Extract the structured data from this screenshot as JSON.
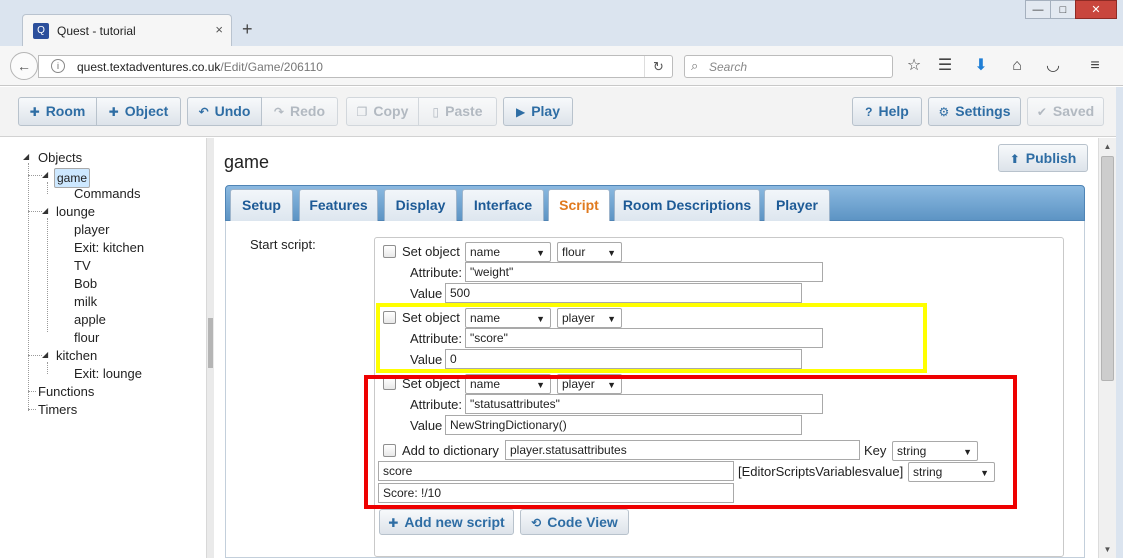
{
  "browser": {
    "tab_title": "Quest - tutorial",
    "tab_close": "×",
    "new_tab": "+",
    "url_host": "quest.textadventures.co.uk",
    "url_path": "/Edit/Game/206110",
    "search_placeholder": "Search",
    "win_minimize": "—",
    "win_maximize": "□",
    "win_close": "✕"
  },
  "toolbar": {
    "room": "Room",
    "object": "Object",
    "undo": "Undo",
    "redo": "Redo",
    "copy": "Copy",
    "paste": "Paste",
    "play": "Play",
    "help": "Help",
    "settings": "Settings",
    "saved": "Saved"
  },
  "tree": {
    "objects": "Objects",
    "game": "game",
    "commands": "Commands",
    "lounge": "lounge",
    "player": "player",
    "exit_kitchen": "Exit: kitchen",
    "tv": "TV",
    "bob": "Bob",
    "milk": "milk",
    "apple": "apple",
    "flour": "flour",
    "kitchen": "kitchen",
    "exit_lounge": "Exit: lounge",
    "functions": "Functions",
    "timers": "Timers"
  },
  "editor": {
    "title": "game",
    "publish": "Publish",
    "tabs": [
      "Setup",
      "Features",
      "Display",
      "Interface",
      "Script",
      "Room Descriptions",
      "Player"
    ],
    "start_script_label": "Start script:"
  },
  "script": {
    "set_object_label": "Set object",
    "attribute_label": "Attribute:",
    "value_label": "Value",
    "blocks": [
      {
        "mode": "name",
        "object": "flour",
        "attribute": "\"weight\"",
        "value": "500"
      },
      {
        "mode": "name",
        "object": "player",
        "attribute": "\"score\"",
        "value": "0"
      },
      {
        "mode": "name",
        "object": "player",
        "attribute": "\"statusattributes\"",
        "value": "NewStringDictionary()"
      }
    ],
    "add_to_dict": {
      "label": "Add to dictionary",
      "dictionary": "player.statusattributes",
      "key_label": "Key",
      "key_type": "string",
      "key_value": "score",
      "value_label": "[EditorScriptsVariablesvalue]",
      "value_type": "string",
      "value_value": "Score: !/10"
    },
    "add_new_script": "Add new script",
    "code_view": "Code View"
  },
  "colors": {
    "highlight_yellow": "#ffff00",
    "highlight_red": "#ee0000",
    "button_text": "#2e6da4",
    "active_tab": "#e07a1f"
  }
}
